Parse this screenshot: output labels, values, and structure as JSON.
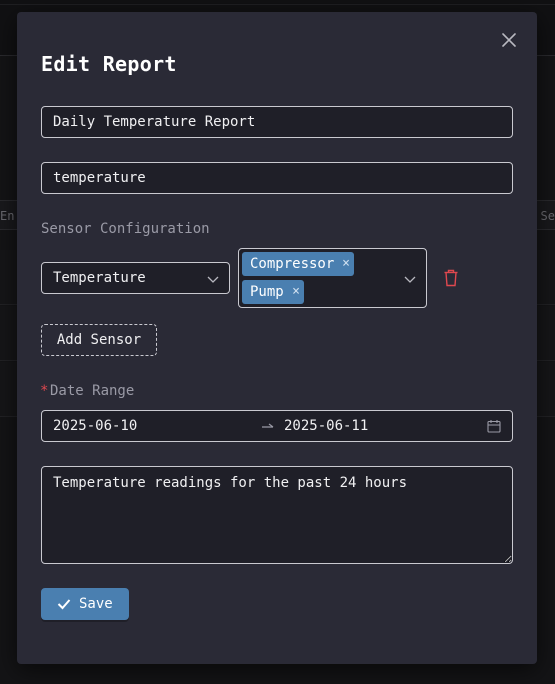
{
  "background": {
    "table_header_left": "En",
    "table_header_right": "Se"
  },
  "modal": {
    "title": "Edit Report",
    "close_icon": "close-icon",
    "report_name": "Daily Temperature Report",
    "report_type": "temperature",
    "sensor_section_label": "Sensor Configuration",
    "sensor": {
      "type_selected": "Temperature",
      "devices": [
        "Compressor",
        "Pump"
      ],
      "remove_tag_glyph": "×"
    },
    "add_sensor_label": "Add Sensor",
    "date_range": {
      "required_marker": "*",
      "label": "Date Range",
      "start": "2025-06-10",
      "end": "2025-06-11"
    },
    "description": "Temperature readings for the past 24 hours",
    "save_label": "Save"
  },
  "colors": {
    "accent": "#4a7fb0",
    "danger": "#e0484f",
    "modal_bg": "#2a2a36",
    "field_border": "#c9c9d0"
  }
}
